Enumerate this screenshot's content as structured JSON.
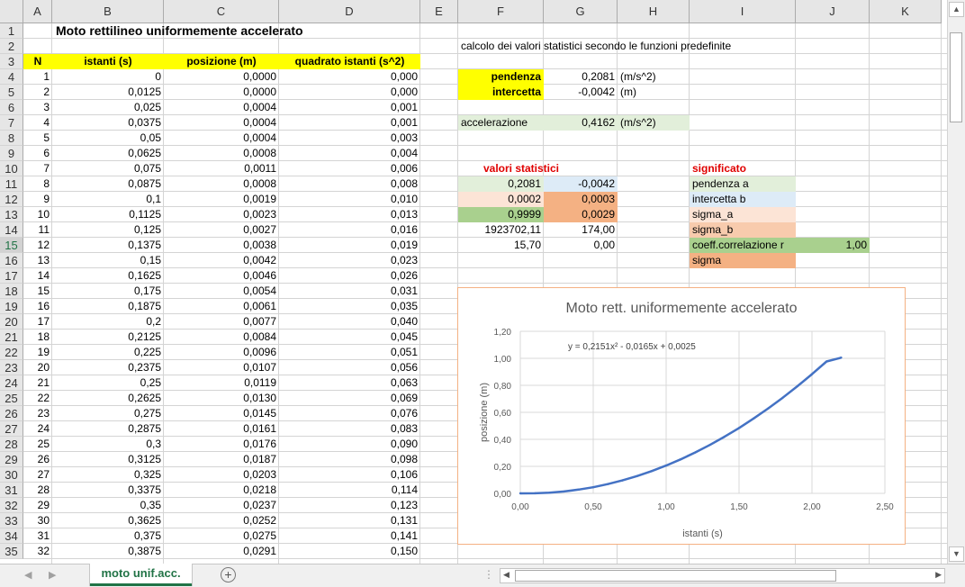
{
  "columns": [
    "A",
    "B",
    "C",
    "D",
    "E",
    "F",
    "G",
    "H",
    "I",
    "J",
    "K"
  ],
  "rows": [
    "1",
    "2",
    "3",
    "4",
    "5",
    "6",
    "7",
    "8",
    "9",
    "10",
    "11",
    "12",
    "13",
    "14",
    "15",
    "16",
    "17",
    "18",
    "19",
    "20",
    "21",
    "22",
    "23",
    "24",
    "25",
    "26",
    "27",
    "28",
    "29",
    "30",
    "31",
    "32",
    "33",
    "34",
    "35"
  ],
  "selected_row": "15",
  "title": "Moto rettilineo uniformemente accelerato",
  "headers": {
    "n": "N",
    "istanti": "istanti (s)",
    "posizione": "posizione (m)",
    "quadrato": "quadrato istanti (s^2)"
  },
  "table": [
    [
      "1",
      "0",
      "0,0000",
      "0,000"
    ],
    [
      "2",
      "0,0125",
      "0,0000",
      "0,000"
    ],
    [
      "3",
      "0,025",
      "0,0004",
      "0,001"
    ],
    [
      "4",
      "0,0375",
      "0,0004",
      "0,001"
    ],
    [
      "5",
      "0,05",
      "0,0004",
      "0,003"
    ],
    [
      "6",
      "0,0625",
      "0,0008",
      "0,004"
    ],
    [
      "7",
      "0,075",
      "0,0011",
      "0,006"
    ],
    [
      "8",
      "0,0875",
      "0,0008",
      "0,008"
    ],
    [
      "9",
      "0,1",
      "0,0019",
      "0,010"
    ],
    [
      "10",
      "0,1125",
      "0,0023",
      "0,013"
    ],
    [
      "11",
      "0,125",
      "0,0027",
      "0,016"
    ],
    [
      "12",
      "0,1375",
      "0,0038",
      "0,019"
    ],
    [
      "13",
      "0,15",
      "0,0042",
      "0,023"
    ],
    [
      "14",
      "0,1625",
      "0,0046",
      "0,026"
    ],
    [
      "15",
      "0,175",
      "0,0054",
      "0,031"
    ],
    [
      "16",
      "0,1875",
      "0,0061",
      "0,035"
    ],
    [
      "17",
      "0,2",
      "0,0077",
      "0,040"
    ],
    [
      "18",
      "0,2125",
      "0,0084",
      "0,045"
    ],
    [
      "19",
      "0,225",
      "0,0096",
      "0,051"
    ],
    [
      "20",
      "0,2375",
      "0,0107",
      "0,056"
    ],
    [
      "21",
      "0,25",
      "0,0119",
      "0,063"
    ],
    [
      "22",
      "0,2625",
      "0,0130",
      "0,069"
    ],
    [
      "23",
      "0,275",
      "0,0145",
      "0,076"
    ],
    [
      "24",
      "0,2875",
      "0,0161",
      "0,083"
    ],
    [
      "25",
      "0,3",
      "0,0176",
      "0,090"
    ],
    [
      "26",
      "0,3125",
      "0,0187",
      "0,098"
    ],
    [
      "27",
      "0,325",
      "0,0203",
      "0,106"
    ],
    [
      "28",
      "0,3375",
      "0,0218",
      "0,114"
    ],
    [
      "29",
      "0,35",
      "0,0237",
      "0,123"
    ],
    [
      "30",
      "0,3625",
      "0,0252",
      "0,131"
    ],
    [
      "31",
      "0,375",
      "0,0275",
      "0,141"
    ],
    [
      "32",
      "0,3875",
      "0,0291",
      "0,150"
    ]
  ],
  "right": {
    "calc_title": "calcolo dei valori statistici secondo le funzioni predefinite",
    "pendenza_label": "pendenza",
    "pendenza_value": "0,2081",
    "pendenza_unit": "(m/s^2)",
    "intercetta_label": "intercetta",
    "intercetta_value": "-0,0042",
    "intercetta_unit": "(m)",
    "acc_label": "accelerazione",
    "acc_value": "0,4162",
    "acc_unit": "(m/s^2)",
    "stat_title": "valori statistici",
    "stats": [
      [
        "0,2081",
        "-0,0042"
      ],
      [
        "0,0002",
        "0,0003"
      ],
      [
        "0,9999",
        "0,0029"
      ],
      [
        "1923702,11",
        "174,00"
      ],
      [
        "15,70",
        "0,00"
      ]
    ],
    "sig_title": "significato",
    "sig": [
      "pendenza a",
      "intercetta b",
      "sigma_a",
      "sigma_b",
      "coeff.correlazione r",
      "sigma"
    ],
    "r_value": "1,00"
  },
  "sheet_tab": "moto unif.acc.",
  "colors": {
    "accent": "#217346",
    "series": "#4472c4",
    "chart_border": "#f4b183"
  },
  "chart_data": {
    "type": "line",
    "title": "Moto rett. uniformemente accelerato",
    "xlabel": "istanti (s)",
    "ylabel": "posizione (m)",
    "trendline": "y = 0,2151x² - 0,0165x + 0,0025",
    "xlim": [
      0,
      2.5
    ],
    "ylim": [
      0,
      1.2
    ],
    "xticks": [
      "0,00",
      "0,50",
      "1,00",
      "1,50",
      "2,00",
      "2,50"
    ],
    "yticks": [
      "0,00",
      "0,20",
      "0,40",
      "0,60",
      "0,80",
      "1,00",
      "1,20"
    ],
    "grid": true,
    "series": [
      {
        "x": [
          0,
          0.1,
          0.2,
          0.3,
          0.4,
          0.5,
          0.6,
          0.7,
          0.8,
          0.9,
          1.0,
          1.1,
          1.2,
          1.3,
          1.4,
          1.5,
          1.6,
          1.7,
          1.8,
          1.9,
          2.0,
          2.1,
          2.2
        ],
        "y": [
          0.0,
          0.0007,
          0.005,
          0.0139,
          0.0277,
          0.0456,
          0.0684,
          0.0958,
          0.1277,
          0.1644,
          0.206,
          0.2522,
          0.3032,
          0.359,
          0.4193,
          0.4843,
          0.5545,
          0.6295,
          0.709,
          0.7935,
          0.8825,
          0.9765,
          1.005
        ]
      }
    ]
  }
}
